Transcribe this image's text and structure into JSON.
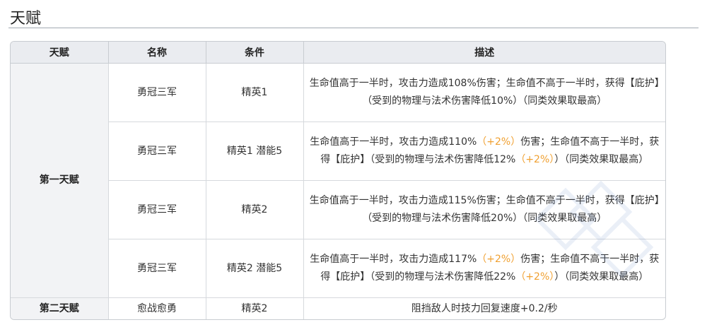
{
  "section": {
    "title": "天赋"
  },
  "table": {
    "headers": [
      "天赋",
      "名称",
      "条件",
      "描述"
    ],
    "groups": [
      "第一天赋",
      "第二天赋"
    ],
    "rows": [
      {
        "name": "勇冠三军",
        "condition": "精英1",
        "desc_parts": [
          "生命值高于一半时，攻击力造成108%伤害；生命值不高于一半时，获得【庇护】（受到的物理与法术伤害降低10%）（同类效果取最高）"
        ]
      },
      {
        "name": "勇冠三军",
        "condition": "精英1 潜能5",
        "desc_parts": [
          "生命值高于一半时，攻击力造成110%",
          "（+2%）",
          "伤害；生命值不高于一半时，获得【庇护】（受到的物理与法术伤害降低12%",
          "（+2%）",
          "）（同类效果取最高）"
        ]
      },
      {
        "name": "勇冠三军",
        "condition": "精英2",
        "desc_parts": [
          "生命值高于一半时，攻击力造成115%伤害；生命值不高于一半时，获得【庇护】（受到的物理与法术伤害降低20%）（同类效果取最高）"
        ]
      },
      {
        "name": "勇冠三军",
        "condition": "精英2 潜能5",
        "desc_parts": [
          "生命值高于一半时，攻击力造成117%",
          "（+2%）",
          "伤害；生命值不高于一半时，获得【庇护】（受到的物理与法术伤害降低22%",
          "（+2%）",
          "）（同类效果取最高）"
        ]
      },
      {
        "name": "愈战愈勇",
        "condition": "精英2",
        "desc_parts": [
          "阻挡敌人时技力回复速度+0.2/秒"
        ]
      }
    ]
  },
  "colors": {
    "highlight": "#f0a030",
    "header_bg": "#eaecf0",
    "border": "#c8ccd1"
  }
}
